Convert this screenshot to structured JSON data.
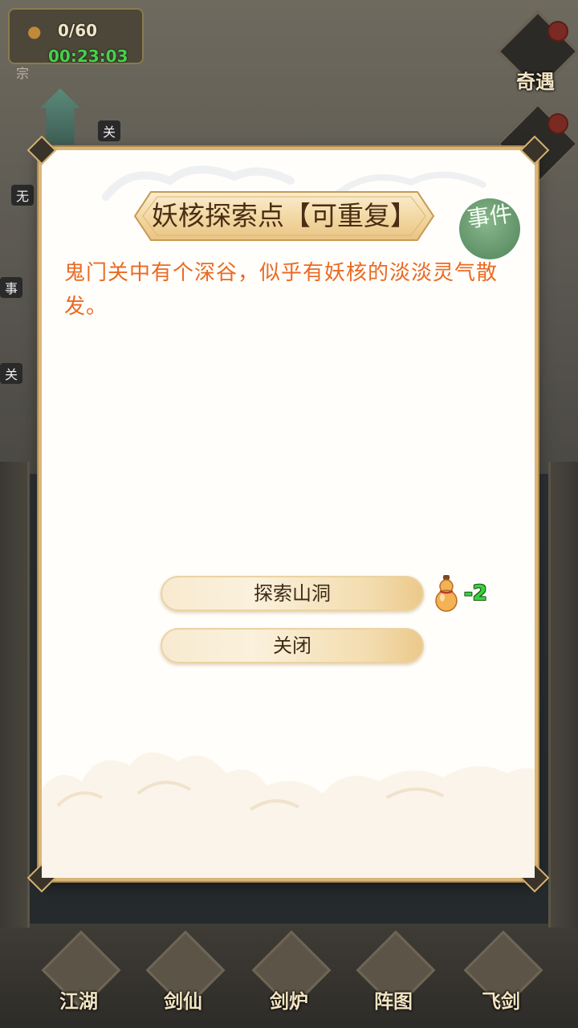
{
  "hud": {
    "counter": "0/60",
    "timer": "00:23:03",
    "side_label": "宗",
    "tag_guan": "关",
    "tag_wu": "无",
    "tag_shi": "事",
    "tag_guan2": "关"
  },
  "side_events": [
    {
      "label": "奇遇"
    }
  ],
  "bottom_tabs": [
    {
      "label": "江湖"
    },
    {
      "label": "剑仙"
    },
    {
      "label": "剑炉"
    },
    {
      "label": "阵图"
    },
    {
      "label": "飞剑"
    }
  ],
  "dialog": {
    "title": "妖核探索点【可重复】",
    "seal_text": "事件",
    "description": "鬼门关中有个深谷，似乎有妖核的淡淡灵气散发。",
    "buttons": {
      "explore_label": "探索山洞",
      "close_label": "关闭"
    },
    "cost": {
      "icon": "gourd-icon",
      "value": "-2"
    }
  },
  "colors": {
    "description": "#ea6a22",
    "cost": "#3bd23c",
    "timer": "#46d04a",
    "frame_gold": "#d9b77a"
  }
}
